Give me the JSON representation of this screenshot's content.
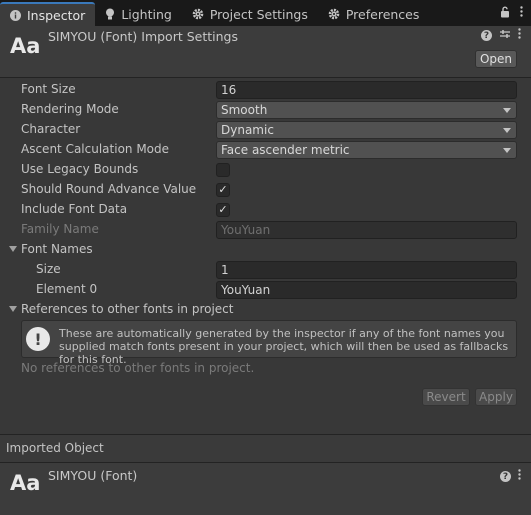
{
  "tabs": [
    {
      "label": "Inspector",
      "icon": "info-icon"
    },
    {
      "label": "Lighting",
      "icon": "bulb-icon"
    },
    {
      "label": "Project Settings",
      "icon": "gear-icon"
    },
    {
      "label": "Preferences",
      "icon": "gear-icon"
    }
  ],
  "header": {
    "aa": "Aa",
    "title": "SIMYOU (Font) Import Settings",
    "open_label": "Open"
  },
  "props": {
    "font_size": {
      "label": "Font Size",
      "value": "16"
    },
    "rendering_mode": {
      "label": "Rendering Mode",
      "value": "Smooth"
    },
    "character": {
      "label": "Character",
      "value": "Dynamic"
    },
    "ascent": {
      "label": "Ascent Calculation Mode",
      "value": "Face ascender metric"
    },
    "legacy_bounds": {
      "label": "Use Legacy Bounds",
      "checked": false
    },
    "round_advance": {
      "label": "Should Round Advance Value",
      "checked": true
    },
    "include_font_data": {
      "label": "Include Font Data",
      "checked": true
    },
    "family_name": {
      "label": "Family Name",
      "value": "YouYuan"
    },
    "font_names": {
      "label": "Font Names"
    },
    "size": {
      "label": "Size",
      "value": "1"
    },
    "element0": {
      "label": "Element 0",
      "value": "YouYuan"
    },
    "references": {
      "label": "References to other fonts in project"
    }
  },
  "info": {
    "text": "These are automatically generated by the inspector if any of the font names you supplied match fonts present in your project, which will then be used as fallbacks for this font.",
    "no_refs": "No references to other fonts in project."
  },
  "buttons": {
    "revert": "Revert",
    "apply": "Apply"
  },
  "imported": {
    "label": "Imported Object",
    "aa": "Aa",
    "title": "SIMYOU (Font)"
  },
  "check_glyph": "✓"
}
